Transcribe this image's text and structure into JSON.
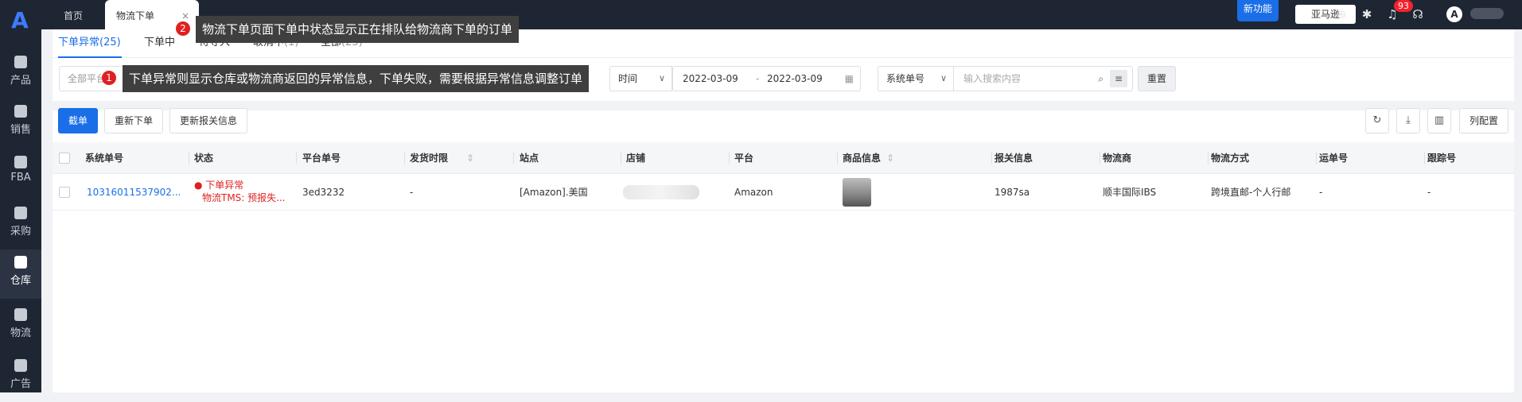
{
  "sidebar": {
    "items": [
      {
        "label": "产品",
        "icon": "bag-icon"
      },
      {
        "label": "销售",
        "icon": "sell-icon"
      },
      {
        "label": "FBA",
        "icon": "fba-icon"
      },
      {
        "label": "采购",
        "icon": "cart-icon"
      },
      {
        "label": "仓库",
        "icon": "warehouse-icon",
        "active": true
      },
      {
        "label": "物流",
        "icon": "truck-icon"
      },
      {
        "label": "广告",
        "icon": "ad-icon"
      }
    ]
  },
  "topbar": {
    "tabs": [
      {
        "label": "首页"
      },
      {
        "label": "物流下单",
        "active": true,
        "close": "×"
      }
    ],
    "new_feature": "新功能",
    "amazon": "亚马逊",
    "badge_count": "93"
  },
  "tooltips": [
    {
      "num": "2",
      "text": "物流下单页面下单中状态显示正在排队给物流商下单的订单"
    },
    {
      "num": "1",
      "text": "下单异常则显示仓库或物流商返回的异常信息，下单失败，需要根据异常信息调整订单"
    }
  ],
  "subtabs": [
    {
      "label": "下单异常",
      "count": "(25)",
      "active": true
    },
    {
      "label": "下单中",
      "count": ""
    },
    {
      "label": "待导入",
      "count": ""
    },
    {
      "label": "取消中",
      "count": "(1)"
    },
    {
      "label": "全部",
      "count": "(25)"
    }
  ],
  "filters": {
    "platform_placeholder": "全部平台",
    "time_type": "时间",
    "date_start": "2022-03-09",
    "date_sep": "-",
    "date_end": "2022-03-09",
    "search_type": "系统单号",
    "search_placeholder": "输入搜索内容",
    "reset": "重置"
  },
  "actions": {
    "primary": "截单",
    "reorder": "重新下单",
    "update_customs": "更新报关信息",
    "column_config": "列配置"
  },
  "table": {
    "headers": [
      "系统单号",
      "状态",
      "平台单号",
      "发货时限",
      "站点",
      "店铺",
      "平台",
      "商品信息",
      "报关信息",
      "物流商",
      "物流方式",
      "运单号",
      "跟踪号"
    ],
    "rows": [
      {
        "system_no": "10316011537902...",
        "status": "下单异常",
        "status_detail": "物流TMS: 预报失...",
        "platform_no": "3ed3232",
        "ship_limit": "-",
        "site": "[Amazon].美国",
        "platform": "Amazon",
        "customs": "1987sa",
        "carrier": "顺丰国际IBS",
        "method": "跨境直邮-个人行邮",
        "waybill": "-",
        "tracking": "-"
      }
    ]
  },
  "colors": {
    "accent": "#1a6ee8",
    "sidebar": "#1f2633",
    "error": "#e02020"
  }
}
